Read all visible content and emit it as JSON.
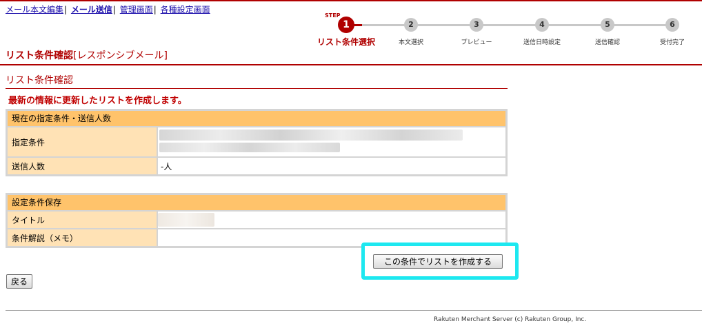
{
  "nav": {
    "items": [
      {
        "label": "メール本文編集",
        "current": false
      },
      {
        "label": "メール送信",
        "current": true
      },
      {
        "label": "管理画面",
        "current": false
      },
      {
        "label": "各種設定画面",
        "current": false
      }
    ]
  },
  "stepper": {
    "tag": "STEP",
    "steps": [
      {
        "number": "1",
        "label": "リスト条件選択",
        "active": true
      },
      {
        "number": "2",
        "label": "本文選択",
        "active": false
      },
      {
        "number": "3",
        "label": "プレビュー",
        "active": false
      },
      {
        "number": "4",
        "label": "送信日時設定",
        "active": false
      },
      {
        "number": "5",
        "label": "送信確認",
        "active": false
      },
      {
        "number": "6",
        "label": "受付完了",
        "active": false
      }
    ]
  },
  "page": {
    "title_bold": "リスト条件確認",
    "title_sub": "[レスポンシブメール]",
    "section_title": "リスト条件確認",
    "notice": "最新の情報に更新したリストを作成します。"
  },
  "conditions_panel": {
    "heading": "現在の指定条件・送信人数",
    "rows": [
      {
        "label": "指定条件",
        "value": ""
      },
      {
        "label": "送信人数",
        "value": "-人"
      }
    ]
  },
  "save_panel": {
    "heading": "設定条件保存",
    "rows": [
      {
        "label": "タイトル",
        "value": ""
      },
      {
        "label": "条件解説（メモ）",
        "value": ""
      }
    ]
  },
  "buttons": {
    "create": "この条件でリストを作成する",
    "back": "戻る"
  },
  "footer": {
    "copyright": "Rakuten Merchant Server (c) Rakuten Group, Inc."
  },
  "colors": {
    "brand_red": "#b00000",
    "panel_header": "#ffc36b",
    "label_cell": "#ffe2b5",
    "highlight": "#1de8f0"
  }
}
